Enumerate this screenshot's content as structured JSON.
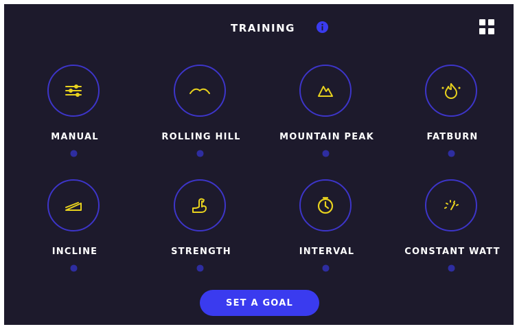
{
  "header": {
    "title": "TRAINING",
    "info_icon": "info-icon",
    "menu_icon": "grid-icon"
  },
  "programs": [
    {
      "label": "MANUAL",
      "icon": "sliders-icon"
    },
    {
      "label": "ROLLING HILL",
      "icon": "rolling-hill-icon"
    },
    {
      "label": "MOUNTAIN PEAK",
      "icon": "mountain-icon"
    },
    {
      "label": "FATBURN",
      "icon": "flame-icon"
    },
    {
      "label": "INCLINE",
      "icon": "incline-icon"
    },
    {
      "label": "STRENGTH",
      "icon": "bicep-icon"
    },
    {
      "label": "INTERVAL",
      "icon": "timer-icon"
    },
    {
      "label": "CONSTANT WATT",
      "icon": "gauge-icon"
    }
  ],
  "goal_button": {
    "label": "SET A GOAL"
  },
  "colors": {
    "background": "#1d1a2c",
    "accent_ring": "#3d35c9",
    "icon": "#e8d21e",
    "button": "#3a3bef",
    "info": "#3a3bef"
  }
}
